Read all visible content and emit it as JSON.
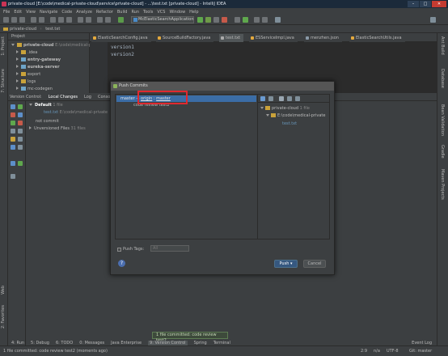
{
  "window": {
    "title": "private-cloud [E:\\code\\medical-private-cloud\\service\\private-cloud] - ...\\test.txt [private-cloud] - IntelliJ IDEA"
  },
  "menu": [
    "File",
    "Edit",
    "View",
    "Navigate",
    "Code",
    "Analyze",
    "Refactor",
    "Build",
    "Run",
    "Tools",
    "VCS",
    "Window",
    "Help"
  ],
  "toolbar": {
    "run_config": "McElasticSearchApplication"
  },
  "navbar": {
    "crumbs": [
      "private-cloud",
      "test.txt"
    ]
  },
  "project": {
    "header": "Project",
    "root": "private-cloud",
    "root_path": "E:\\code\\medical-pri",
    "items": [
      ".idea",
      "entry-gateway",
      "eureka-server",
      "export",
      "logs",
      "mc-codegen"
    ]
  },
  "editor": {
    "tabs": [
      "ElasticSearchConfig.java",
      "SourceBuildFactory.java",
      "test.txt",
      "ESServiceImpl.java",
      "menzhen.json",
      "ElasticSearchUtils.java"
    ],
    "lines": [
      "version1",
      "version2"
    ]
  },
  "vcs": {
    "tabs": [
      "Version Control:",
      "Local Changes",
      "Log",
      "Console"
    ],
    "default_label": "Default",
    "default_count": "1 file",
    "file": "test.txt",
    "file_path": "E:\\code\\medical-private",
    "not_commit": "not commit",
    "unversioned": "Unversioned Files",
    "unversioned_count": "31 files"
  },
  "dialog": {
    "title": "Push Commits",
    "branch": "master",
    "arrow": "→",
    "remote": "origin",
    "sep": ":",
    "target": "master",
    "commit_msg": "code review test2",
    "tree_root": "private-cloud",
    "tree_root_count": "1 file",
    "tree_path": "E:\\code\\medical-private",
    "tree_file": "test.txt",
    "push_tags_label": "Push Tags:",
    "tags_value": "All",
    "help": "?",
    "push_label": "Push",
    "cancel_label": "Cancel"
  },
  "left_strip": [
    "1: Project",
    "7: Structure",
    "2: Favorites",
    "Web"
  ],
  "right_strip": [
    "Ant Build",
    "Database",
    "Bean Validation",
    "Gradle",
    "Maven Projects"
  ],
  "bottom_tabs": [
    "4: Run",
    "5: Debug",
    "6: TODO",
    "0: Messages",
    "Java Enterprise",
    "9: Version Control",
    "Spring",
    "Terminal"
  ],
  "event_log": "Event Log",
  "balloon": "1 file committed: code review test2",
  "status": {
    "message": "1 file committed: code review test2 (moments ago)",
    "position": "2:9",
    "line_sep": "n/a",
    "encoding": "UTF-8",
    "git": "Git: master"
  }
}
